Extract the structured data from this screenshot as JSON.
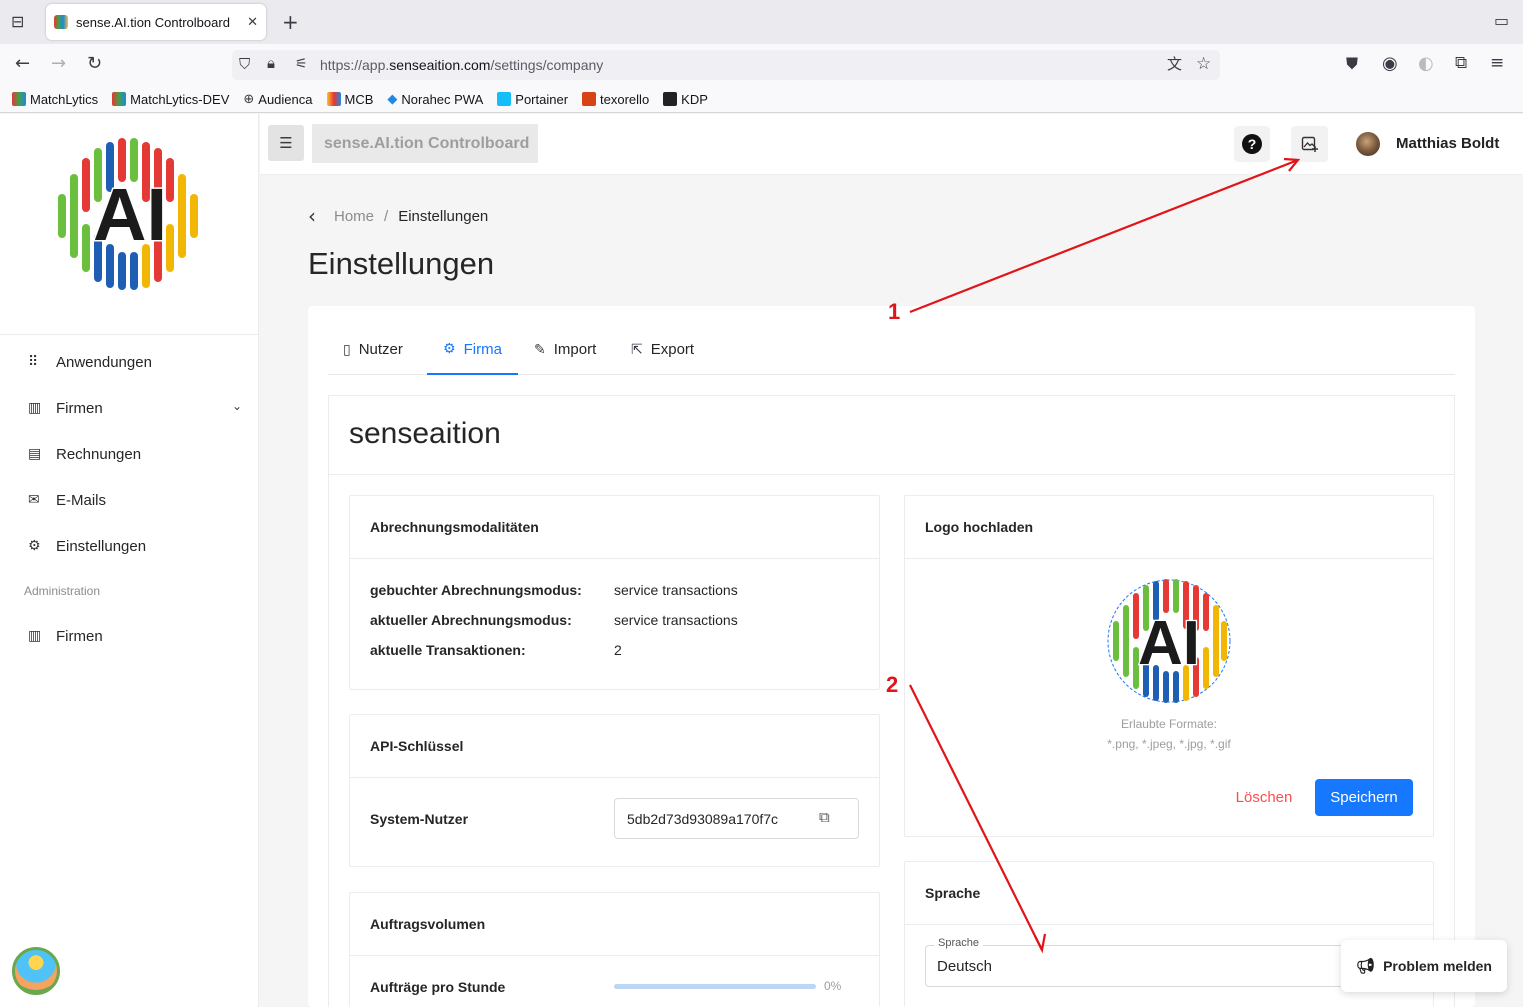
{
  "browser": {
    "tab_title": "sense.AI.tion Controlboard",
    "url_prefix": "https://app.",
    "url_domain": "senseaition.com",
    "url_path": "/settings/company",
    "bookmarks": [
      "MatchLytics",
      "MatchLytics-DEV",
      "Audienca",
      "MCB",
      "Norahec PWA",
      "Portainer",
      "texorello",
      "KDP"
    ]
  },
  "header": {
    "app_title": "sense.AI.tion Controlboard",
    "user_name": "Matthias Boldt"
  },
  "sidebar": {
    "items": [
      {
        "label": "Anwendungen",
        "icon": "grid-icon"
      },
      {
        "label": "Firmen",
        "icon": "building-icon"
      },
      {
        "label": "Rechnungen",
        "icon": "invoice-icon"
      },
      {
        "label": "E-Mails",
        "icon": "mail-icon"
      },
      {
        "label": "Einstellungen",
        "icon": "gear-icon"
      }
    ],
    "section_label": "Administration",
    "admin_items": [
      {
        "label": "Firmen",
        "icon": "building-icon"
      }
    ]
  },
  "breadcrumb": {
    "home": "Home",
    "separator": "/",
    "current": "Einstellungen"
  },
  "page": {
    "title": "Einstellungen",
    "tabs": [
      {
        "label": "Nutzer",
        "icon": "document-icon"
      },
      {
        "label": "Firma",
        "icon": "gear-icon",
        "active": true
      },
      {
        "label": "Import",
        "icon": "edit-icon"
      },
      {
        "label": "Export",
        "icon": "export-icon"
      }
    ],
    "company_name": "senseaition"
  },
  "billing": {
    "title": "Abrechnungsmodalitäten",
    "rows": [
      {
        "label": "gebuchter Abrechnungsmodus:",
        "value": "service transactions"
      },
      {
        "label": "aktueller Abrechnungsmodus:",
        "value": "service transactions"
      },
      {
        "label": "aktuelle Transaktionen:",
        "value": "2"
      }
    ]
  },
  "api": {
    "title": "API-Schlüssel",
    "label": "System-Nutzer",
    "value": "5db2d73d93089a170f7c"
  },
  "orders": {
    "title": "Auftragsvolumen",
    "label": "Aufträge pro Stunde",
    "percent": "0%"
  },
  "logo": {
    "title": "Logo hochladen",
    "formats_label": "Erlaubte Formate:",
    "formats": "*.png, *.jpeg, *.jpg, *.gif",
    "delete_label": "Löschen",
    "save_label": "Speichern"
  },
  "language": {
    "title": "Sprache",
    "field_label": "Sprache",
    "value": "Deutsch"
  },
  "problem_button": "Problem melden",
  "annotations": {
    "one": "1",
    "two": "2"
  },
  "colors": {
    "accent": "#1677ff",
    "danger": "#ff4d4f",
    "annotation": "#e0151a"
  }
}
